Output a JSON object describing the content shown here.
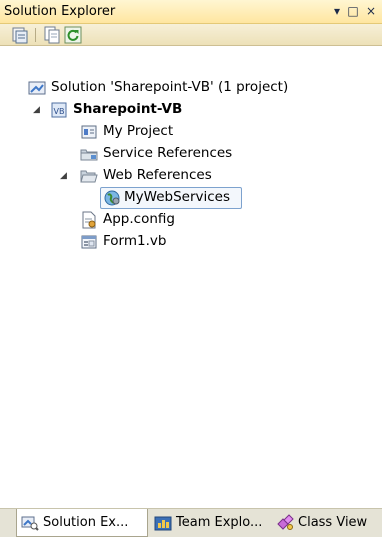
{
  "window": {
    "title": "Solution Explorer",
    "pin_glyph": "▾",
    "maximize_glyph": "□",
    "close_glyph": "×"
  },
  "toolbar": {
    "buttons": [
      {
        "icon": "properties-icon"
      },
      {
        "icon": "show-all-files-icon"
      },
      {
        "icon": "refresh-icon"
      }
    ]
  },
  "tree": {
    "solution_label": "Solution 'Sharepoint-VB' (1 project)",
    "project_label": "Sharepoint-VB",
    "items": {
      "my_project": "My Project",
      "service_references": "Service References",
      "web_references": "Web References",
      "mywebservices": "MyWebServices",
      "app_config": "App.config",
      "form1": "Form1.vb"
    },
    "expanded_glyph": "◢",
    "selected": "MyWebServices"
  },
  "tabs": [
    {
      "label": "Solution Ex...",
      "icon": "solution-explorer-icon",
      "active": true
    },
    {
      "label": "Team Explo...",
      "icon": "team-explorer-icon",
      "active": false
    },
    {
      "label": "Class View",
      "icon": "class-view-icon",
      "active": false
    }
  ],
  "colors": {
    "title_bar": "#ffe6a0",
    "selection_border": "#7da2ce",
    "tab_strip": "#e5e3d6"
  }
}
